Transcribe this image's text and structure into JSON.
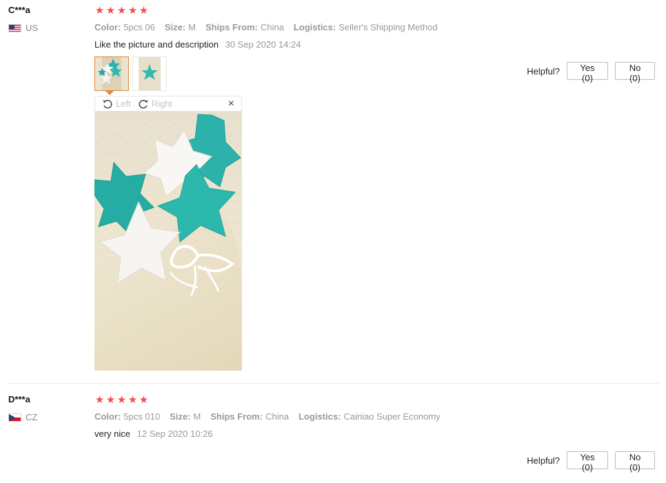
{
  "reviews": [
    {
      "user": "C***a",
      "country": "US",
      "rating_stars": 5,
      "stars": [
        "★",
        "★",
        "★",
        "★",
        "★"
      ],
      "attributes": [
        {
          "key": "Color:",
          "value": "5pcs 06"
        },
        {
          "key": "Size:",
          "value": "M"
        },
        {
          "key": "Ships From:",
          "value": "China"
        },
        {
          "key": "Logistics:",
          "value": "Seller's Shipping Method"
        }
      ],
      "text": "Like the picture and description",
      "date": "30 Sep 2020 14:24",
      "helpful": {
        "label": "Helpful?",
        "yes": "Yes (0)",
        "no": "No (0)"
      },
      "viewer": {
        "left": "Left",
        "right": "Right",
        "close": "×"
      }
    },
    {
      "user": "D***a",
      "country": "CZ",
      "rating_stars": 5,
      "stars": [
        "★",
        "★",
        "★",
        "★",
        "★"
      ],
      "attributes": [
        {
          "key": "Color:",
          "value": "5pcs 010"
        },
        {
          "key": "Size:",
          "value": "M"
        },
        {
          "key": "Ships From:",
          "value": "China"
        },
        {
          "key": "Logistics:",
          "value": "Cainiao Super Economy"
        }
      ],
      "text": "very nice",
      "date": "12 Sep 2020 10:26",
      "helpful": {
        "label": "Helpful?",
        "yes": "Yes (0)",
        "no": "No (0)"
      }
    }
  ],
  "colors": {
    "star": "#f44b4b",
    "active_thumb_border": "#e4843a",
    "muted_text": "#999999",
    "teal": "#2bb3ab"
  },
  "icons": [
    "rotate-left-icon",
    "rotate-right-icon",
    "close-icon",
    "star-icon",
    "us-flag-icon",
    "cz-flag-icon"
  ]
}
